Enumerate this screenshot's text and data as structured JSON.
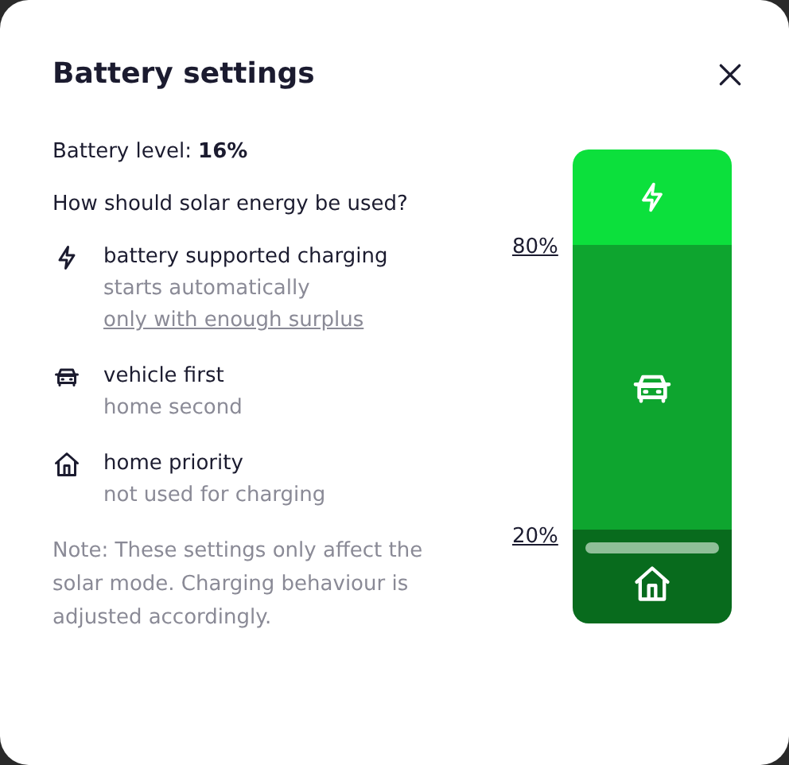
{
  "dialog": {
    "title": "Battery settings"
  },
  "battery": {
    "label": "Battery level:",
    "value": "16%"
  },
  "question": "How should solar energy be used?",
  "options": [
    {
      "kind": "bolt",
      "title": "battery supported charging",
      "subtitle": "starts automatically",
      "link": "only with enough surplus"
    },
    {
      "kind": "car",
      "title": "vehicle first",
      "subtitle": "home second"
    },
    {
      "kind": "home",
      "title": "home priority",
      "subtitle": "not used for charging"
    }
  ],
  "note": "Note: These settings only affect the solar mode. Charging behaviour is adjusted accordingly.",
  "thresholds": {
    "upper": "80%",
    "lower": "20%"
  }
}
